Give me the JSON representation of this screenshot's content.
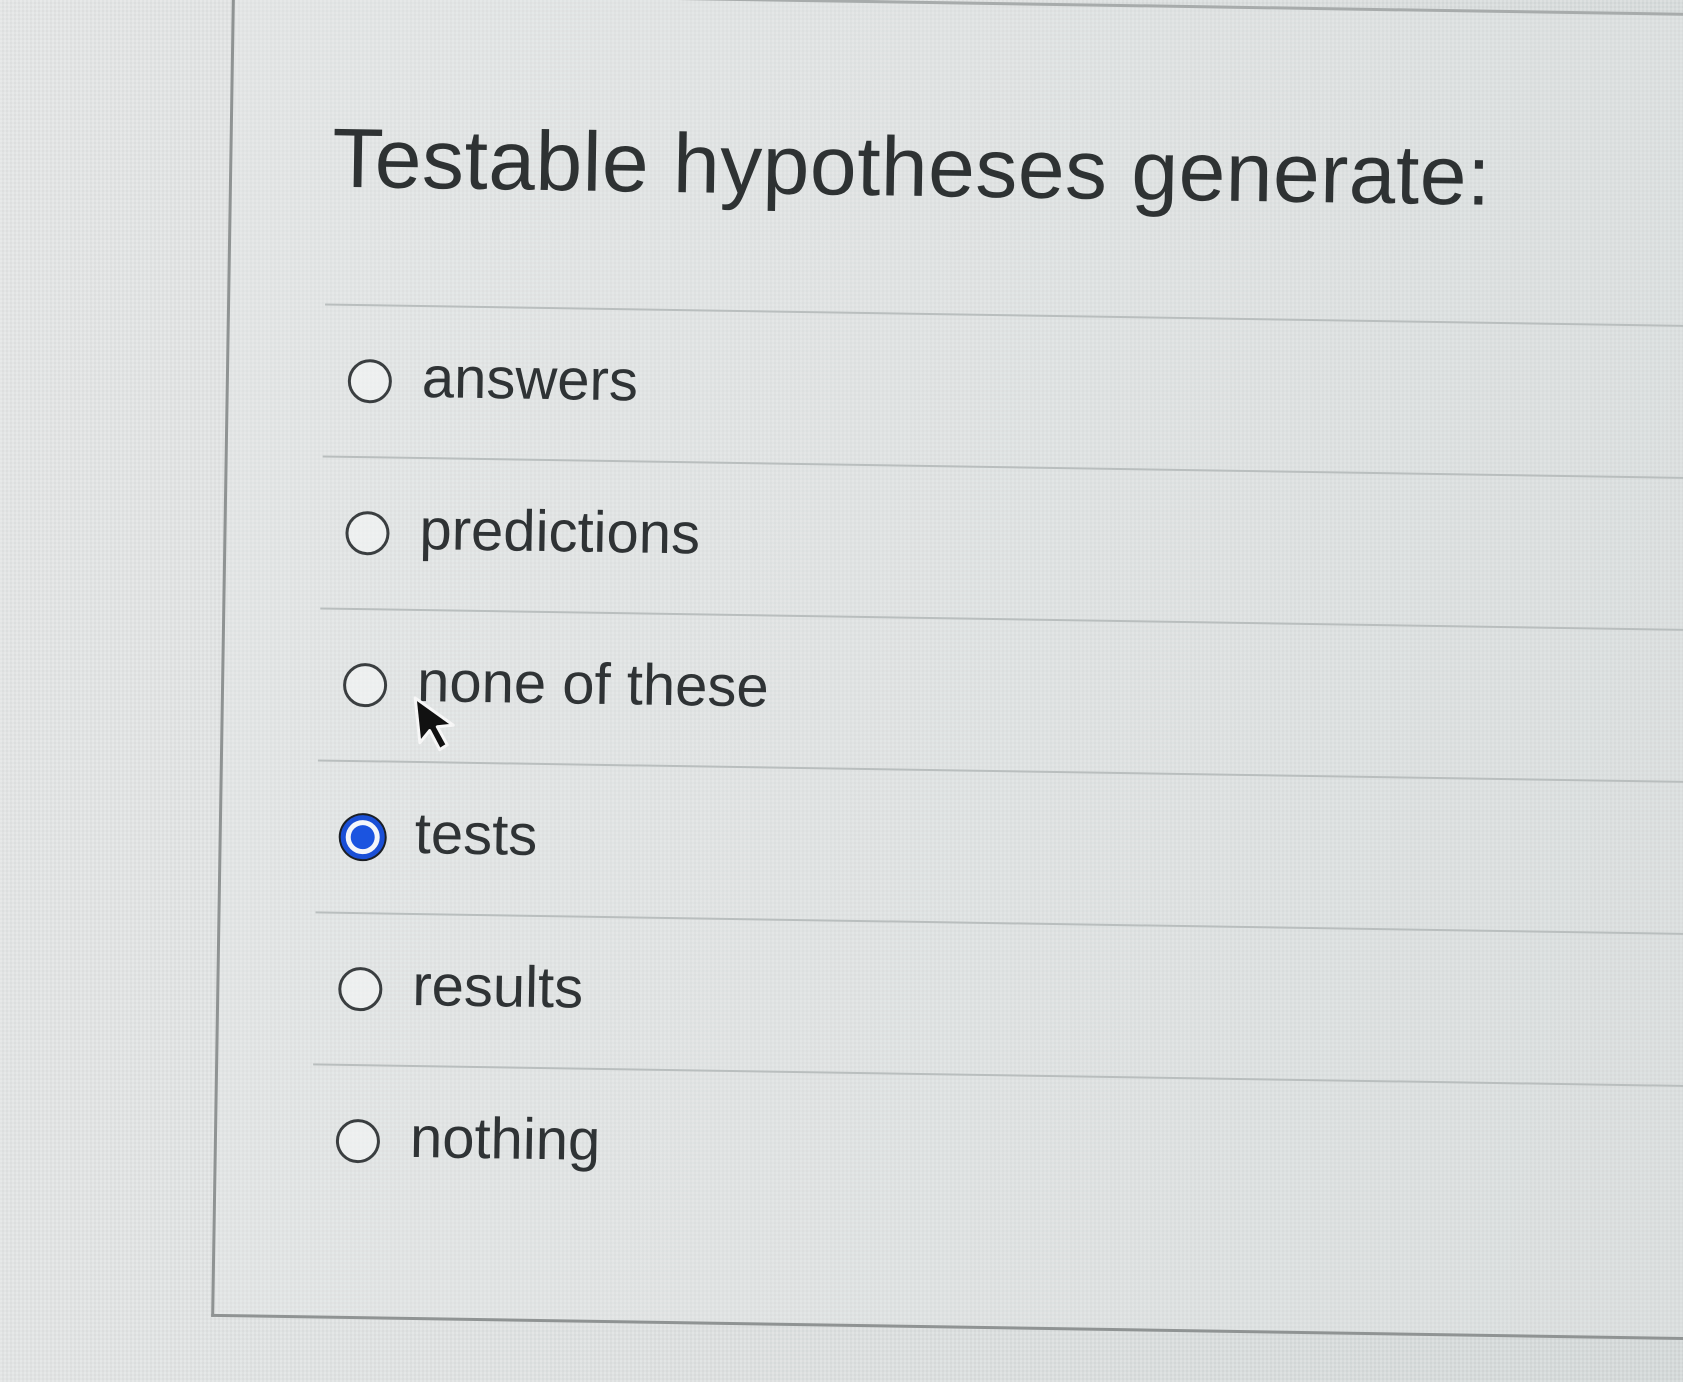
{
  "question": {
    "title": "Testable hypotheses generate:"
  },
  "options": [
    {
      "label": "answers",
      "selected": false
    },
    {
      "label": "predictions",
      "selected": false
    },
    {
      "label": "none of these",
      "selected": false
    },
    {
      "label": "tests",
      "selected": true
    },
    {
      "label": "results",
      "selected": false
    },
    {
      "label": "nothing",
      "selected": false
    }
  ],
  "colors": {
    "selected_radio": "#1b54e0",
    "text": "#2f3335",
    "divider": "#b9bebe"
  },
  "icons": {
    "cursor": "mouse-pointer-icon",
    "radio": "radio-button-icon"
  }
}
